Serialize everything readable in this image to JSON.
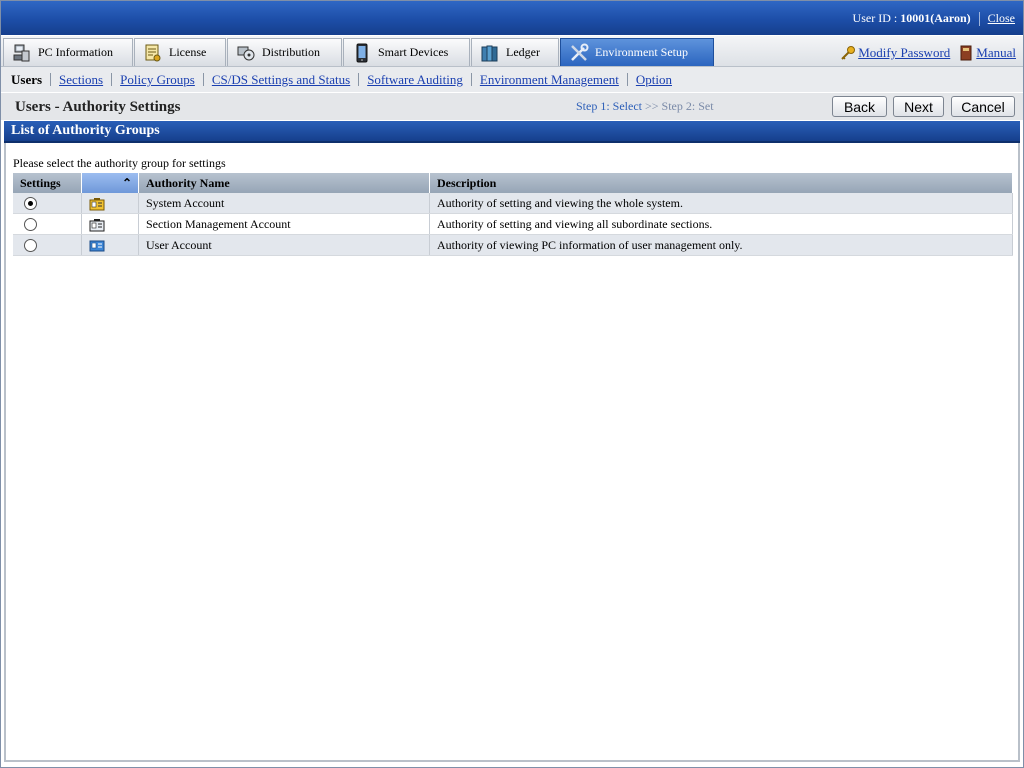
{
  "header": {
    "user_id_label": "User ID :",
    "user_id_value": "10001(Aaron)",
    "close_label": "Close"
  },
  "tabs": [
    {
      "label": "PC Information",
      "icon": "pc-icon",
      "active": false
    },
    {
      "label": "License",
      "icon": "license-icon",
      "active": false
    },
    {
      "label": "Distribution",
      "icon": "distribution-icon",
      "active": false
    },
    {
      "label": "Smart Devices",
      "icon": "smart-device-icon",
      "active": false
    },
    {
      "label": "Ledger",
      "icon": "ledger-icon",
      "active": false
    },
    {
      "label": "Environment Setup",
      "icon": "tools-icon",
      "active": true
    }
  ],
  "right_links": {
    "modify_password": "Modify Password",
    "manual": "Manual"
  },
  "subnav": {
    "current": "Users",
    "items": [
      "Sections",
      "Policy Groups",
      "CS/DS Settings and Status",
      "Software Auditing",
      "Environment Management",
      "Option"
    ]
  },
  "page": {
    "title": "Users - Authority Settings",
    "step_current": "Step 1: Select",
    "step_sep": ">>",
    "step_next": "Step 2: Set",
    "back_label": "Back",
    "next_label": "Next",
    "cancel_label": "Cancel"
  },
  "section": {
    "title": "List of Authority Groups",
    "instruction": "Please select the authority group for settings"
  },
  "table": {
    "columns": [
      "Settings",
      "",
      "Authority Name",
      "Description"
    ],
    "sort_indicator": "⌃",
    "rows": [
      {
        "selected": true,
        "icon": "system-account-icon",
        "name": "System Account",
        "description": "Authority of setting and viewing the whole system."
      },
      {
        "selected": false,
        "icon": "section-account-icon",
        "name": "Section Management Account",
        "description": "Authority of setting and viewing all subordinate sections."
      },
      {
        "selected": false,
        "icon": "user-account-icon",
        "name": "User Account",
        "description": "Authority of viewing PC information of user management only."
      }
    ]
  }
}
